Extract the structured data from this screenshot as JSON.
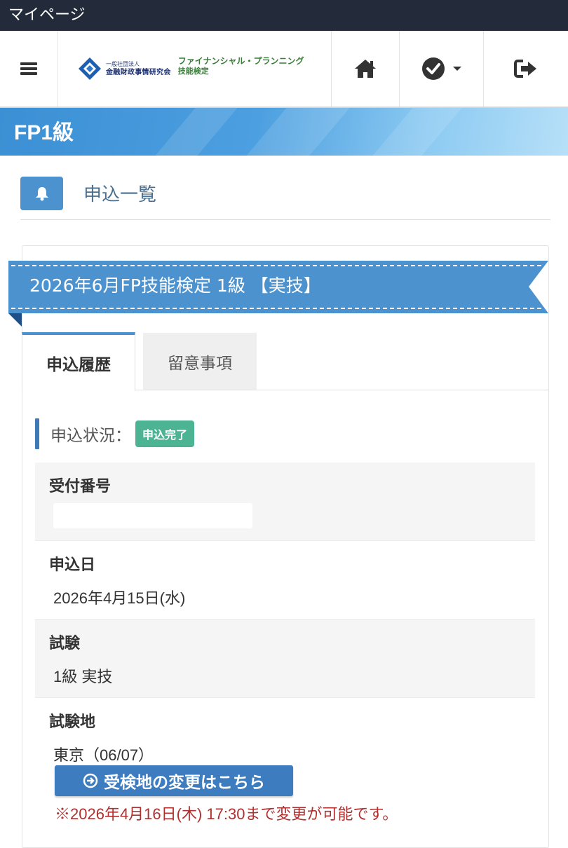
{
  "titlebar": {
    "title": "マイページ"
  },
  "navbar": {
    "logo_org_small": "一般社団法人",
    "logo_org_main": "金融財政事情研究会",
    "logo_prog_line1": "ファイナンシャル・プランニング",
    "logo_prog_line2": "技能検定",
    "icons": [
      "menu-icon",
      "home-icon",
      "check-circle-icon",
      "caret-down-icon",
      "sign-out-icon"
    ]
  },
  "page": {
    "title": "FP1級"
  },
  "section": {
    "title": "申込一覧",
    "icon": "bell-icon"
  },
  "exam": {
    "title": "2026年6月FP技能検定 1級 【実技】"
  },
  "tabs": [
    {
      "label": "申込履歴",
      "active": true
    },
    {
      "label": "留意事項",
      "active": false
    }
  ],
  "status": {
    "label": "申込状況：",
    "badge": "申込完了",
    "badge_color": "#4cb393"
  },
  "details": {
    "receipt_number": {
      "label": "受付番号",
      "value": ""
    },
    "apply_date": {
      "label": "申込日",
      "value": "2026年4月15日(水)"
    },
    "exam": {
      "label": "試験",
      "value": "1級 実技"
    },
    "location": {
      "label": "試験地",
      "value": "東京（06/07）"
    }
  },
  "change": {
    "button_label": "受検地の変更はこちら",
    "note": "※2026年4月16日(木) 17:30まで変更が可能です。"
  },
  "colors": {
    "accent": "#4b92cf",
    "header_dark": "#232b3a",
    "note_red": "#b03030"
  }
}
